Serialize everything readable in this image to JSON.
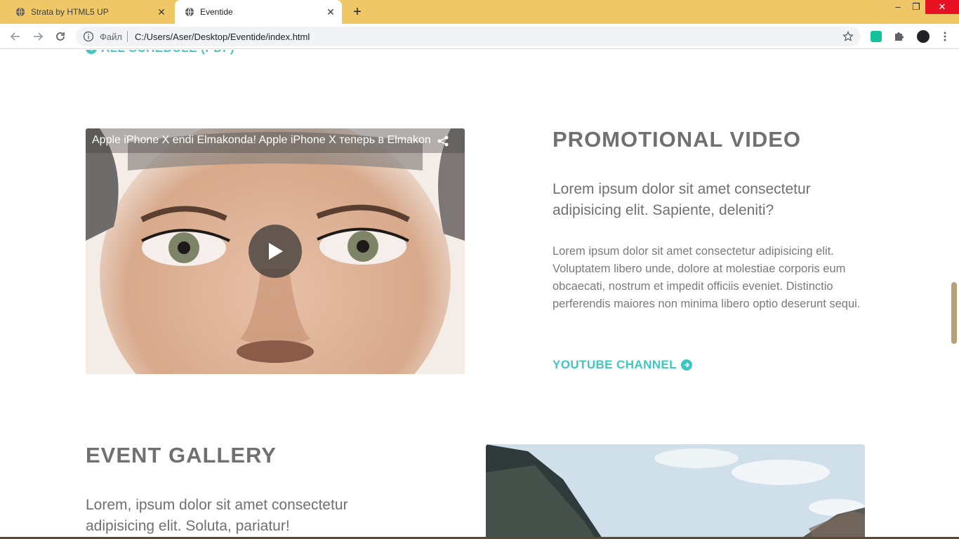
{
  "browser": {
    "tabs": [
      {
        "title": "Strata by HTML5 UP",
        "close": "✕"
      },
      {
        "title": "Eventide",
        "close": "✕"
      }
    ],
    "new_tab": "+",
    "window_controls": {
      "minimize": "–",
      "maximize": "❐",
      "close": "✕"
    },
    "omnibox": {
      "scheme_label": "Файл",
      "url": "C:/Users/Aser/Desktop/Eventide/index.html"
    },
    "colors": {
      "tabstrip": "#f0c766",
      "accent": "#3cc8c0"
    }
  },
  "page": {
    "top_link": "ALL SCHEDULE (PDF)",
    "video": {
      "title": "Apple iPhone X endi Elmakonda! Apple iPhone X теперь в Elmakon"
    },
    "promo": {
      "title": "PROMOTIONAL VIDEO",
      "subtitle": "Lorem ipsum dolor sit amet consectetur adipisicing elit. Sapiente, deleniti?",
      "body": "Lorem ipsum dolor sit amet consectetur adipisicing elit. Voluptatem libero unde, dolore at molestiae corporis eum obcaecati, nostrum et impedit officiis eveniet. Distinctio perferendis maiores non minima libero optio deserunt sequi.",
      "link": "YOUTUBE CHANNEL"
    },
    "gallery": {
      "title": "EVENT GALLERY",
      "subtitle": "Lorem, ipsum dolor sit amet consectetur adipisicing elit. Soluta, pariatur!"
    }
  }
}
